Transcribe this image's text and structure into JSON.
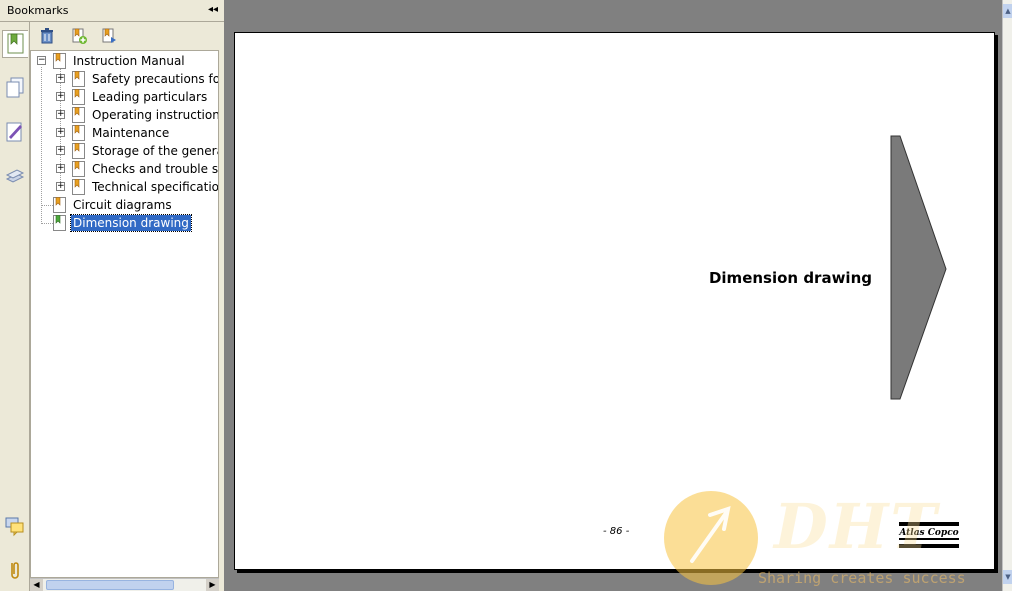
{
  "panel": {
    "title": "Bookmarks",
    "collapse_glyph": "◂◂"
  },
  "toolbar": {
    "delete_icon": "trash-icon",
    "new_bookmark_icon": "new-bookmark-icon",
    "bookmark_options_icon": "bookmark-options-icon"
  },
  "tree": {
    "root": {
      "label": "Instruction Manual",
      "expanded": true
    },
    "children": [
      {
        "label": "Safety precautions for p",
        "expandable": true
      },
      {
        "label": "Leading particulars",
        "expandable": true
      },
      {
        "label": "Operating instructions",
        "expandable": true
      },
      {
        "label": "Maintenance",
        "expandable": true
      },
      {
        "label": "Storage of the generat",
        "expandable": true
      },
      {
        "label": "Checks and trouble sho",
        "expandable": true
      },
      {
        "label": "Technical specifications",
        "expandable": true
      }
    ],
    "siblings": [
      {
        "label": "Circuit diagrams",
        "selected": false
      },
      {
        "label": "Dimension drawing",
        "selected": true
      }
    ]
  },
  "side_tools": [
    "bookmarks-icon",
    "pages-icon",
    "signatures-icon",
    "layers-icon",
    "comments-icon",
    "attachments-icon"
  ],
  "page": {
    "heading": "Dimension drawing",
    "page_number": "- 86 -",
    "logo_text": "Atlas Copco"
  },
  "watermark": {
    "text": "DHT",
    "tagline": "Sharing creates success"
  },
  "colors": {
    "selection": "#316AC5",
    "panel_bg": "#ECE9D8",
    "doc_bg": "#808080",
    "tab_fill": "#7A7A7A"
  }
}
